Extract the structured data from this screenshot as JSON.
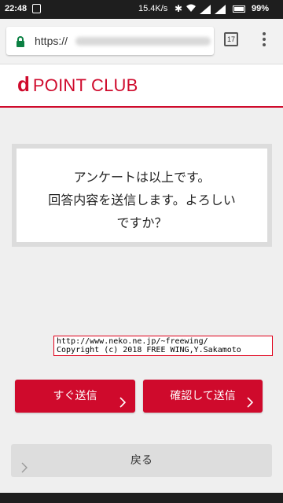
{
  "status_bar": {
    "time": "22:48",
    "network_speed": "15.4K/s",
    "battery": "99%"
  },
  "browser": {
    "url_scheme": "https://",
    "tab_count": "17"
  },
  "header": {
    "logo_mark": "d",
    "logo_text": "POINT CLUB",
    "accent_color": "#cf0a2c"
  },
  "message": {
    "lines": [
      "アンケートは以上です。",
      "回答内容を送信します。よろしい",
      "ですか？"
    ]
  },
  "credit": {
    "line1": "http://www.neko.ne.jp/~freewing/",
    "line2": "Copyright (c) 2018 FREE WING,Y.Sakamoto"
  },
  "buttons": {
    "send_now": "すぐ送信",
    "confirm_send": "確認して送信",
    "back": "戻る"
  }
}
